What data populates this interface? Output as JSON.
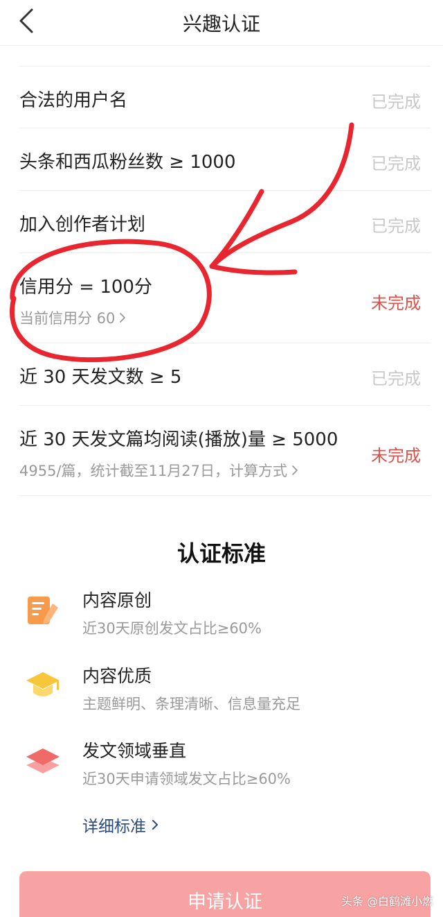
{
  "header": {
    "title": "兴趣认证",
    "back_icon": "chevron-left-icon"
  },
  "requirements": [
    {
      "title": "合法的用户名",
      "status": "已完成",
      "state": "done"
    },
    {
      "title": "头条和西瓜粉丝数 ≥ 1000",
      "status": "已完成",
      "state": "done"
    },
    {
      "title": "加入创作者计划",
      "status": "已完成",
      "state": "done"
    },
    {
      "title": "信用分 = 100分",
      "subtitle": "当前信用分 60",
      "status": "未完成",
      "state": "todo"
    },
    {
      "title": "近 30 天发文数 ≥ 5",
      "status": "已完成",
      "state": "done"
    },
    {
      "title": "近 30 天发文篇均阅读(播放)量 ≥ 5000",
      "subtitle": "4955/篇，统计截至11月27日，计算方式",
      "status": "未完成",
      "state": "todo"
    }
  ],
  "standards": {
    "title": "认证标准",
    "items": [
      {
        "name": "内容原创",
        "desc": "近30天原创发文占比≥60%",
        "icon": "document-edit-icon"
      },
      {
        "name": "内容优质",
        "desc": "主题鲜明、条理清晰、信息量充足",
        "icon": "graduation-cap-icon"
      },
      {
        "name": "发文领域垂直",
        "desc": "近30天申请领域发文占比≥60%",
        "icon": "layers-icon"
      }
    ],
    "detail_link": "详细标准"
  },
  "apply_button": "申请认证",
  "watermark": "头条 @白鹤滩小燃",
  "colors": {
    "done": "#c8c8c8",
    "todo": "#e0504a",
    "link": "#2a4a7a",
    "button": "#f7a3a3",
    "annotation": "#e8262f"
  }
}
